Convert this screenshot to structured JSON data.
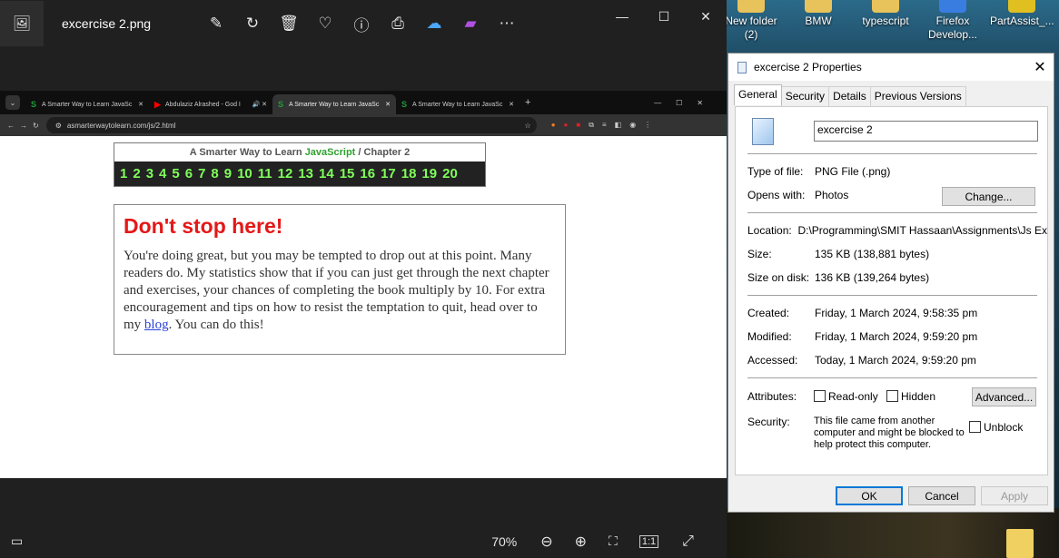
{
  "photos": {
    "file_title": "excercise 2.png",
    "zoom": "70%",
    "toolbar_icons": [
      "edit-icon",
      "rotate-icon",
      "delete-icon",
      "favorite-icon",
      "info-icon",
      "print-icon",
      "onedrive-icon",
      "clipchamp-icon",
      "more-icon"
    ]
  },
  "chrome": {
    "tabs": [
      {
        "label": "A Smarter Way to Learn JavaSc"
      },
      {
        "label": "Abdulaziz Alrashed - God I"
      },
      {
        "label": "A Smarter Way to Learn JavaSc"
      },
      {
        "label": "A Smarter Way to Learn JavaSc"
      }
    ],
    "url": "asmarterwaytolearn.com/js/2.html"
  },
  "site": {
    "header_pre": "A Smarter Way to Learn",
    "header_js": "JavaScript",
    "header_post": "/  Chapter 2",
    "chapters": [
      "1",
      "2",
      "3",
      "4",
      "5",
      "6",
      "7",
      "8",
      "9",
      "10",
      "11",
      "12",
      "13",
      "14",
      "15",
      "16",
      "17",
      "18",
      "19",
      "20"
    ],
    "callout_title": "Don't stop here!",
    "callout_text_1": "You're doing great, but you may be tempted to drop out at this point. Many readers do. My statistics show that if you can just get through the next chapter and exercises, your chances of completing the book multiply by 10. For extra encouragement and tips on how to resist the temptation to quit, head over to my ",
    "callout_link": "blog",
    "callout_text_2": ". You can do this!"
  },
  "desktop": {
    "icons": [
      {
        "label": "New folder (2)"
      },
      {
        "label": "BMW"
      },
      {
        "label": "typescript"
      },
      {
        "label": "Firefox Develop..."
      },
      {
        "label": "PartAssist_..."
      }
    ]
  },
  "properties": {
    "title": "excercise 2 Properties",
    "tabs": [
      "General",
      "Security",
      "Details",
      "Previous Versions"
    ],
    "filename": "excercise 2",
    "type_label": "Type of file:",
    "type_value": "PNG File (.png)",
    "opens_label": "Opens with:",
    "opens_value": "Photos",
    "change_btn": "Change...",
    "location_label": "Location:",
    "location_value": "D:\\Programming\\SMIT Hassaan\\Assignments\\Js Ex",
    "size_label": "Size:",
    "size_value": "135 KB (138,881 bytes)",
    "sod_label": "Size on disk:",
    "sod_value": "136 KB (139,264 bytes)",
    "created_label": "Created:",
    "created_value": "Friday, 1 March 2024, 9:58:35 pm",
    "modified_label": "Modified:",
    "modified_value": "Friday, 1 March 2024, 9:59:20 pm",
    "accessed_label": "Accessed:",
    "accessed_value": "Today, 1 March 2024, 9:59:20 pm",
    "attributes_label": "Attributes:",
    "readonly": "Read-only",
    "hidden": "Hidden",
    "advanced_btn": "Advanced...",
    "security_label": "Security:",
    "security_text": "This file came from another computer and might be blocked to help protect this computer.",
    "unblock": "Unblock",
    "ok": "OK",
    "cancel": "Cancel",
    "apply": "Apply"
  }
}
